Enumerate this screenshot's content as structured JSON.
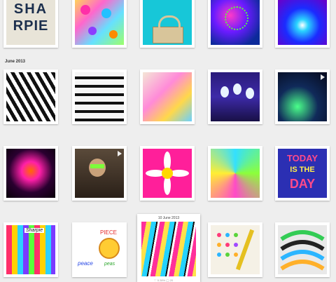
{
  "section_label": "June 2013",
  "expanded": {
    "date": "10 June 2013",
    "meta": "♡ 5 28%  ◯ 20"
  },
  "tiles": {
    "sharpie": {
      "line1": "SHA",
      "line2": "RPIE"
    },
    "today": {
      "line1": "TODAY",
      "line2": "IS THE",
      "line3": "DAY"
    },
    "peace": {
      "word1": "PIECE",
      "word2": "peace",
      "word3": "peas"
    },
    "markers": {
      "brand": "Sharpie"
    }
  },
  "colors": {
    "background": "#eeeeee",
    "tile_frame": "#ffffff"
  }
}
